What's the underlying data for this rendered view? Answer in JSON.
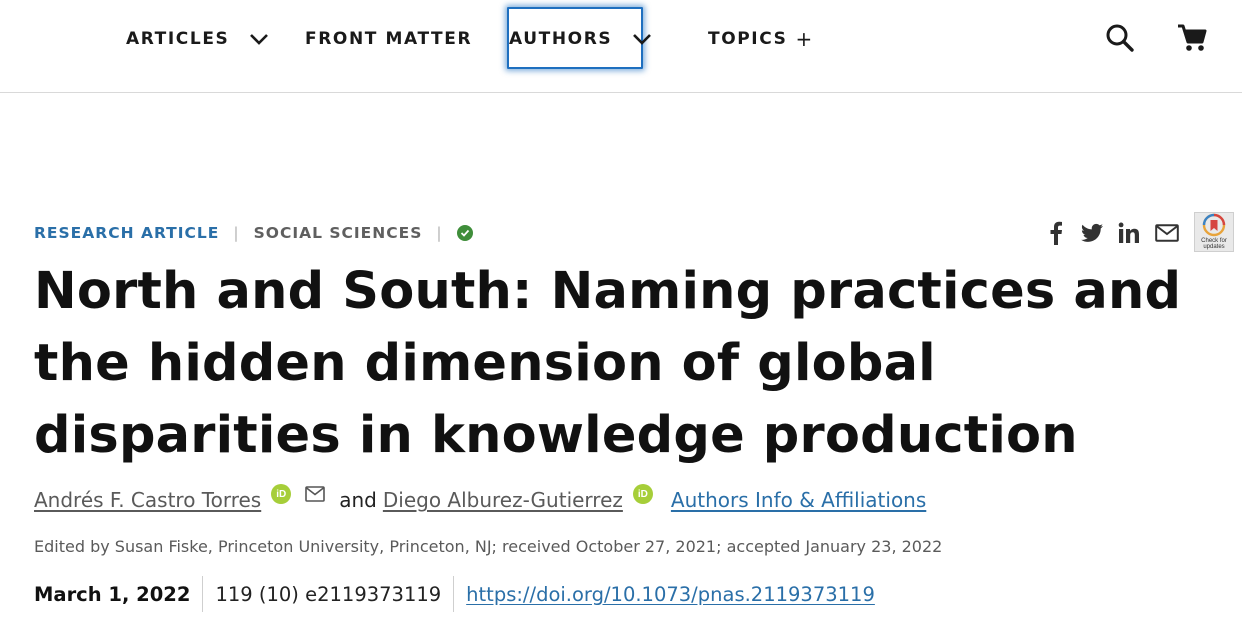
{
  "nav": {
    "items": [
      {
        "label": "ARTICLES"
      },
      {
        "label": "FRONT MATTER"
      },
      {
        "label": "AUTHORS"
      },
      {
        "label": "TOPICS"
      }
    ],
    "topics_plus": "+"
  },
  "icons": {
    "search": "search-icon",
    "cart": "cart-icon",
    "facebook": "facebook-icon",
    "twitter": "twitter-icon",
    "linkedin": "linkedin-icon",
    "email": "email-icon",
    "check_updates": "check-for-updates-icon",
    "orcid": "orcid-icon",
    "verified": "check-icon"
  },
  "article": {
    "type": "RESEARCH ARTICLE",
    "section": "SOCIAL SCIENCES",
    "separator": "|",
    "updates_badge": "Check for updates",
    "title": "North and South: Naming practices and the hidden dimension of global disparities in knowledge production",
    "authors": [
      {
        "name": "Andrés F. Castro Torres"
      },
      {
        "name": "Diego Alburez-Gutierrez"
      }
    ],
    "and_text": "and",
    "orcid_text": "iD",
    "affiliations_link": "Authors Info & Affiliations",
    "edited_line": "Edited by Susan Fiske, Princeton University, Princeton, NJ; received October 27, 2021; accepted January 23, 2022",
    "date": "March 1, 2022",
    "volume": "119 (10) e2119373119",
    "doi": "https://doi.org/10.1073/pnas.2119373119"
  },
  "colors": {
    "link_blue": "#2a6fa8",
    "focus_blue": "#1e6fbf",
    "orcid_green": "#a6ce39",
    "verified_green": "#3f8e3a"
  }
}
